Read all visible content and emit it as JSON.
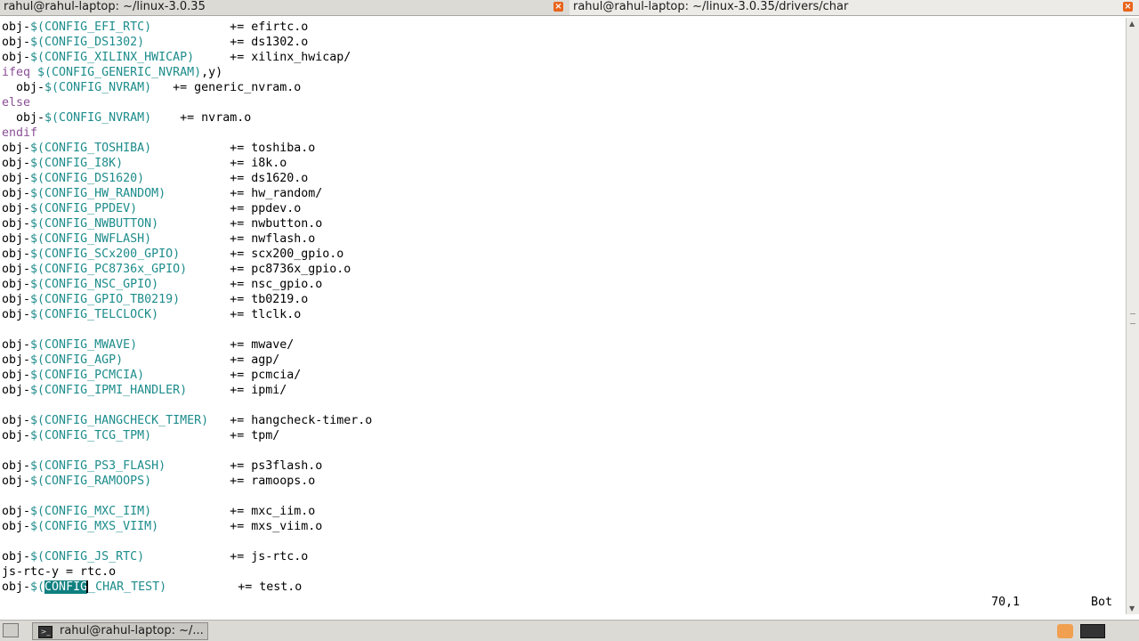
{
  "tabs": [
    {
      "title": "rahul@rahul-laptop: ~/linux-3.0.35",
      "active": false
    },
    {
      "title": "rahul@rahul-laptop: ~/linux-3.0.35/drivers/char",
      "active": true
    }
  ],
  "lines": [
    {
      "type": "obj",
      "config": "CONFIG_EFI_RTC",
      "pad": "           ",
      "target": "efirtc.o"
    },
    {
      "type": "obj",
      "config": "CONFIG_DS1302",
      "pad": "            ",
      "target": "ds1302.o"
    },
    {
      "type": "obj",
      "config": "CONFIG_XILINX_HWICAP",
      "pad": "     ",
      "target": "xilinx_hwicap/"
    },
    {
      "type": "ifeq",
      "text": "ifeq ",
      "var": "$(CONFIG_GENERIC_NVRAM)",
      "rest": ",y)"
    },
    {
      "type": "obj_indent",
      "config": "CONFIG_NVRAM",
      "pad": "   ",
      "target": "generic_nvram.o"
    },
    {
      "type": "kw",
      "text": "else"
    },
    {
      "type": "obj_indent",
      "config": "CONFIG_NVRAM",
      "pad": "    ",
      "target": "nvram.o"
    },
    {
      "type": "kw",
      "text": "endif"
    },
    {
      "type": "obj",
      "config": "CONFIG_TOSHIBA",
      "pad": "           ",
      "target": "toshiba.o"
    },
    {
      "type": "obj",
      "config": "CONFIG_I8K",
      "pad": "               ",
      "target": "i8k.o"
    },
    {
      "type": "obj",
      "config": "CONFIG_DS1620",
      "pad": "            ",
      "target": "ds1620.o"
    },
    {
      "type": "obj",
      "config": "CONFIG_HW_RANDOM",
      "pad": "         ",
      "target": "hw_random/"
    },
    {
      "type": "obj",
      "config": "CONFIG_PPDEV",
      "pad": "             ",
      "target": "ppdev.o"
    },
    {
      "type": "obj",
      "config": "CONFIG_NWBUTTON",
      "pad": "          ",
      "target": "nwbutton.o"
    },
    {
      "type": "obj",
      "config": "CONFIG_NWFLASH",
      "pad": "           ",
      "target": "nwflash.o"
    },
    {
      "type": "obj",
      "config": "CONFIG_SCx200_GPIO",
      "pad": "       ",
      "target": "scx200_gpio.o"
    },
    {
      "type": "obj",
      "config": "CONFIG_PC8736x_GPIO",
      "pad": "      ",
      "target": "pc8736x_gpio.o"
    },
    {
      "type": "obj",
      "config": "CONFIG_NSC_GPIO",
      "pad": "          ",
      "target": "nsc_gpio.o"
    },
    {
      "type": "obj",
      "config": "CONFIG_GPIO_TB0219",
      "pad": "       ",
      "target": "tb0219.o"
    },
    {
      "type": "obj",
      "config": "CONFIG_TELCLOCK",
      "pad": "          ",
      "target": "tlclk.o"
    },
    {
      "type": "blank"
    },
    {
      "type": "obj",
      "config": "CONFIG_MWAVE",
      "pad": "             ",
      "target": "mwave/"
    },
    {
      "type": "obj",
      "config": "CONFIG_AGP",
      "pad": "               ",
      "target": "agp/"
    },
    {
      "type": "obj",
      "config": "CONFIG_PCMCIA",
      "pad": "            ",
      "target": "pcmcia/"
    },
    {
      "type": "obj",
      "config": "CONFIG_IPMI_HANDLER",
      "pad": "      ",
      "target": "ipmi/"
    },
    {
      "type": "blank"
    },
    {
      "type": "obj",
      "config": "CONFIG_HANGCHECK_TIMER",
      "pad": "   ",
      "target": "hangcheck-timer.o"
    },
    {
      "type": "obj",
      "config": "CONFIG_TCG_TPM",
      "pad": "           ",
      "target": "tpm/"
    },
    {
      "type": "blank"
    },
    {
      "type": "obj",
      "config": "CONFIG_PS3_FLASH",
      "pad": "         ",
      "target": "ps3flash.o"
    },
    {
      "type": "obj",
      "config": "CONFIG_RAMOOPS",
      "pad": "           ",
      "target": "ramoops.o"
    },
    {
      "type": "blank"
    },
    {
      "type": "obj",
      "config": "CONFIG_MXC_IIM",
      "pad": "           ",
      "target": "mxc_iim.o"
    },
    {
      "type": "obj",
      "config": "CONFIG_MXS_VIIM",
      "pad": "          ",
      "target": "mxs_viim.o"
    },
    {
      "type": "blank"
    },
    {
      "type": "obj",
      "config": "CONFIG_JS_RTC",
      "pad": "            ",
      "target": "js-rtc.o"
    },
    {
      "type": "plain",
      "text": "js-rtc-y = rtc.o"
    },
    {
      "type": "obj_sel",
      "sel": "CONFIG",
      "config_rest": "_CHAR_TEST",
      "pad": "          ",
      "target": "test.o"
    }
  ],
  "status": {
    "position": "70,1",
    "scroll": "Bot"
  },
  "taskbar": {
    "window_button": "rahul@rahul-laptop: ~/..."
  },
  "colors": {
    "var": "#1e8c8c",
    "keyword": "#8a4f96",
    "selection": "#0f7f80"
  }
}
